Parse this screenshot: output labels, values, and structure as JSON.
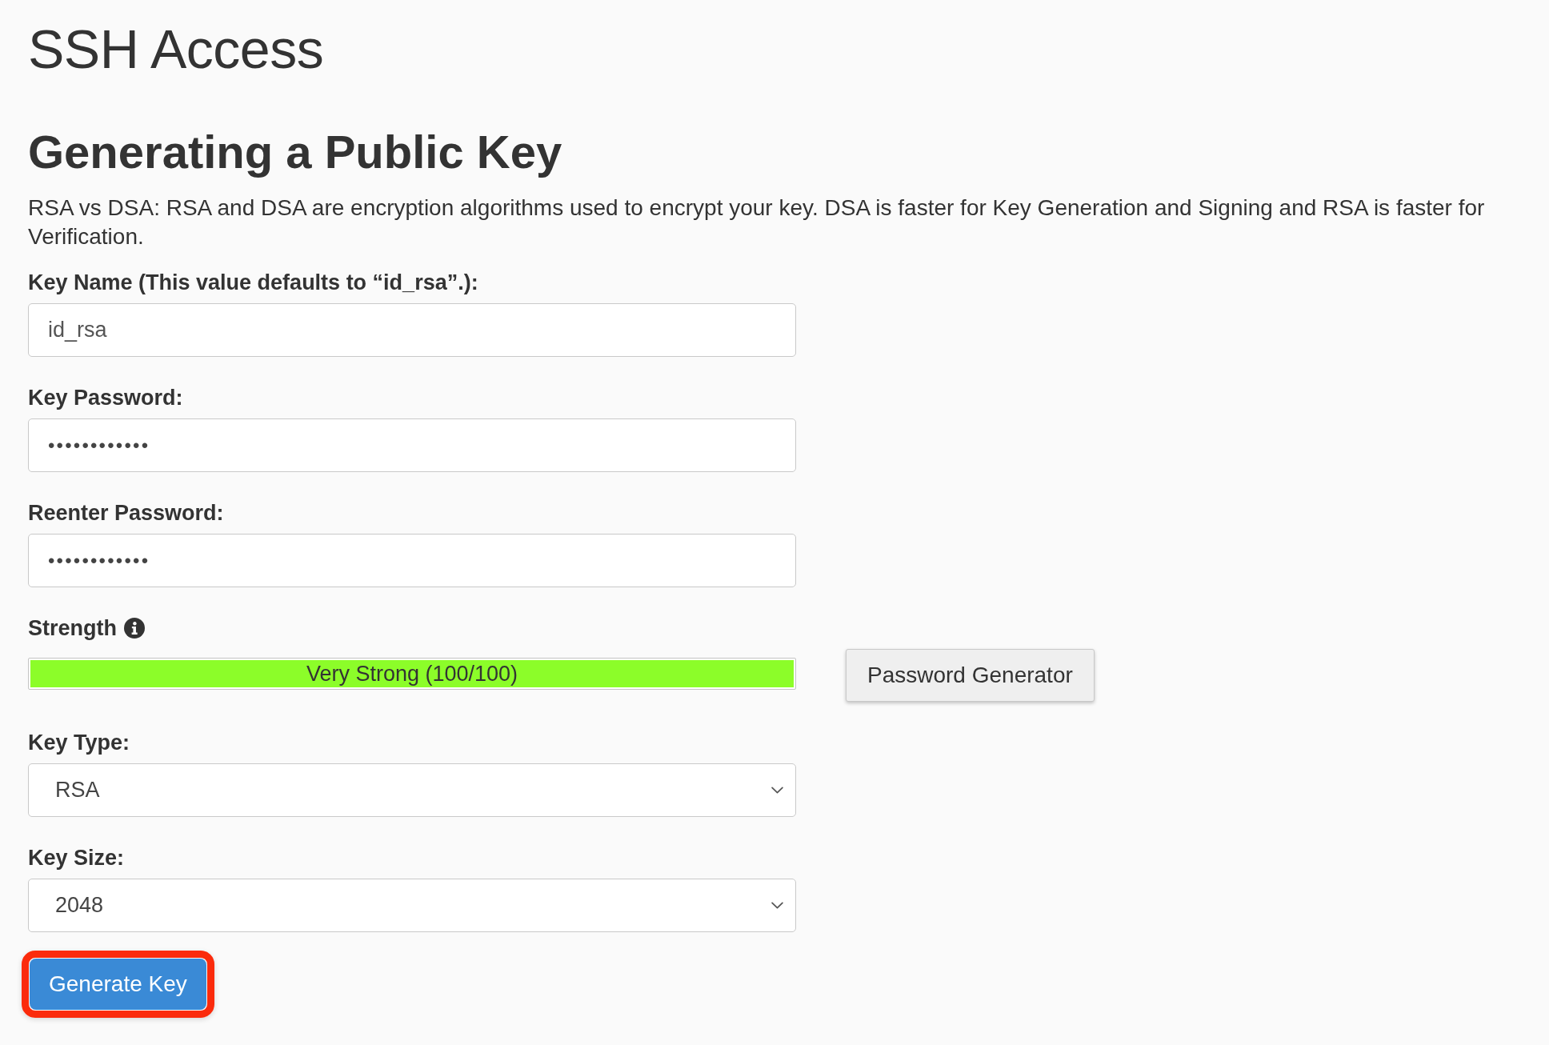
{
  "page_title": "SSH Access",
  "section": {
    "title": "Generating a Public Key",
    "description": "RSA vs DSA: RSA and DSA are encryption algorithms used to encrypt your key. DSA is faster for Key Generation and Signing and RSA is faster for Verification."
  },
  "fields": [
    {
      "kind": "text",
      "label": "Key Name (This value defaults to “id_rsa”.):",
      "value": "id_rsa"
    },
    {
      "kind": "password",
      "label": "Key Password:",
      "value": "••••••••••••"
    },
    {
      "kind": "password",
      "label": "Reenter Password:",
      "value": "••••••••••••"
    }
  ],
  "strength": {
    "label": "Strength",
    "level": 1,
    "reading": "Very Strong (100/100)"
  },
  "password_generator_button": {
    "label": "Password Generator"
  },
  "selects": [
    {
      "label": "Key Type:",
      "value": "RSA"
    },
    {
      "label": "Key Size:",
      "value": "2048"
    }
  ],
  "generate_button": {
    "label": "Generate Key",
    "highlighted": true
  }
}
